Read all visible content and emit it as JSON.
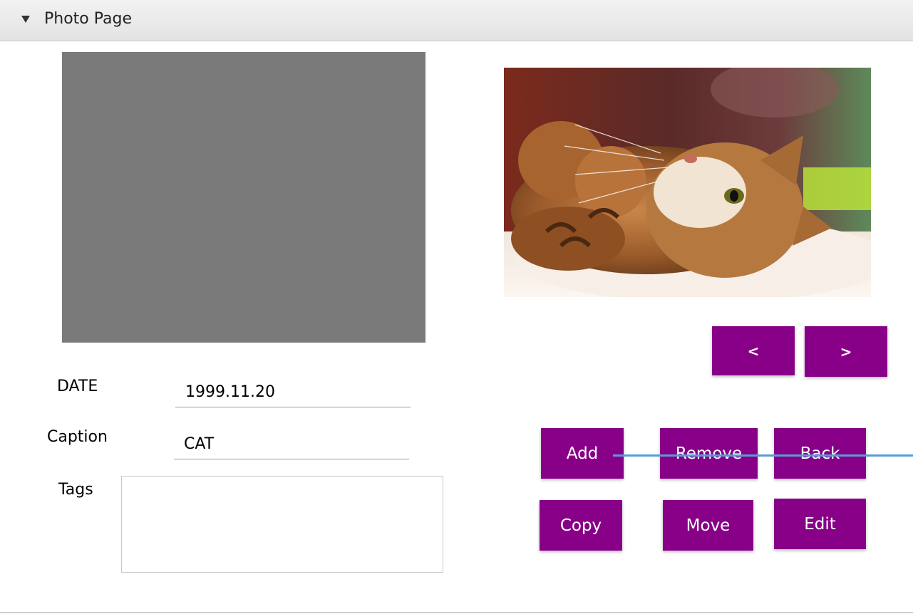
{
  "header": {
    "title": "Photo Page",
    "toggle_icon": "triangle-down-icon"
  },
  "left_pane": {
    "color": "#7a7a7a"
  },
  "photo": {
    "subject": "cat-photo"
  },
  "nav": {
    "prev_label": "<",
    "next_label": ">"
  },
  "form": {
    "date_label": "DATE",
    "date_value": "1999.11.20",
    "caption_label": "Caption",
    "caption_value": "CAT",
    "tags_label": "Tags",
    "tags_value": ""
  },
  "actions": {
    "add": "Add",
    "remove": "Remove",
    "back": "Back",
    "copy": "Copy",
    "move": "Move",
    "edit": "Edit"
  },
  "colors": {
    "button": "#870087",
    "connector": "#5b9bd5"
  }
}
